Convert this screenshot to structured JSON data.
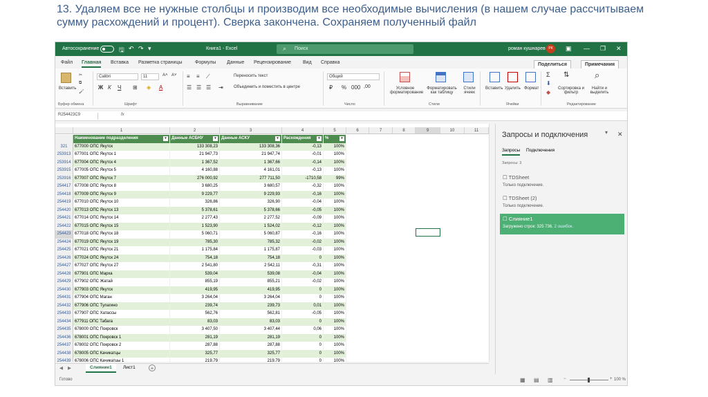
{
  "caption": "13. Удаляем все не нужные столбцы и производим все необходимые вычисления (в нашем случае рассчитываем сумму расхождений и процент). Сверка закончена. Сохраняем полученный файл",
  "titlebar": {
    "autosave": "Автосохранение",
    "title": "Книга1 - Excel",
    "search_placeholder": "Поиск",
    "user": "роман кушнарев",
    "avatar": "РК"
  },
  "tabs": [
    "Файл",
    "Главная",
    "Вставка",
    "Разметка страницы",
    "Формулы",
    "Данные",
    "Рецензирование",
    "Вид",
    "Справка"
  ],
  "tab_actions": {
    "share": "Поделиться",
    "notes": "Примечания"
  },
  "ribbon": {
    "paste": "Вставить",
    "font_name": "Calibri",
    "font_size": "11",
    "wrap_text": "Переносить текст",
    "merge_center": "Объединить и поместить в центре",
    "number_format": "Общий",
    "cond_format": "Условное форматирование",
    "format_table": "Форматировать как таблицу",
    "cell_styles": "Стили ячеек",
    "insert": "Вставить",
    "delete": "Удалить",
    "format": "Формат",
    "sort_filter": "Сортировка и фильтр",
    "find_select": "Найти и выделить",
    "groups": {
      "clipboard": "Буфер обмена",
      "font": "Шрифт",
      "alignment": "Выравнивание",
      "number": "Число",
      "styles": "Стили",
      "cells": "Ячейки",
      "editing": "Редактирование"
    }
  },
  "formula_bar": {
    "name_box": "R254423C9",
    "fx": "fx",
    "value": ""
  },
  "columns": [
    "1",
    "2",
    "3",
    "4",
    "5",
    "6",
    "7",
    "8",
    "9",
    "10",
    "11"
  ],
  "table_headers": [
    "Наименование подразделения",
    "Данные АСБНУ",
    "Данные АСКУ",
    "Расхождения",
    "%"
  ],
  "rows": [
    {
      "n": "321",
      "name": "677000 ОПС Якутск",
      "a": "133 308,23",
      "b": "133 308,36",
      "diff": "-0,13",
      "pct": "100%"
    },
    {
      "n": "253913",
      "name": "677001 ОПС Якутск 1",
      "a": "21 947,73",
      "b": "21 947,74",
      "diff": "-0,01",
      "pct": "100%"
    },
    {
      "n": "253914",
      "name": "677004 ОПС Якутск 4",
      "a": "1 367,52",
      "b": "1 367,66",
      "diff": "-0,14",
      "pct": "100%"
    },
    {
      "n": "253915",
      "name": "677005 ОПС Якутск 5",
      "a": "4 160,88",
      "b": "4 161,01",
      "diff": "-0,13",
      "pct": "100%"
    },
    {
      "n": "253916",
      "name": "677007 ОПС Якутск 7",
      "a": "276 000,92",
      "b": "277 711,50",
      "diff": "-1710,58",
      "pct": "99%"
    },
    {
      "n": "254417",
      "name": "677008 ОПС Якутск 8",
      "a": "3 680,25",
      "b": "3 680,57",
      "diff": "-0,32",
      "pct": "100%"
    },
    {
      "n": "254418",
      "name": "677009 ОПС Якутск 9",
      "a": "9 229,77",
      "b": "9 229,93",
      "diff": "-0,16",
      "pct": "100%"
    },
    {
      "n": "254419",
      "name": "677010 ОПС Якутск 10",
      "a": "326,86",
      "b": "326,90",
      "diff": "-0,04",
      "pct": "100%"
    },
    {
      "n": "254420",
      "name": "677013 ОПС Якутск 13",
      "a": "5 378,61",
      "b": "5 378,66",
      "diff": "-0,05",
      "pct": "100%"
    },
    {
      "n": "254421",
      "name": "677014 ОПС Якутск 14",
      "a": "2 277,43",
      "b": "2 277,52",
      "diff": "-0,09",
      "pct": "100%"
    },
    {
      "n": "254422",
      "name": "677015 ОПС Якутск 15",
      "a": "1 523,90",
      "b": "1 524,02",
      "diff": "-0,12",
      "pct": "100%"
    },
    {
      "n": "254423",
      "name": "677018 ОПС Якутск 18",
      "a": "5 060,71",
      "b": "5 060,87",
      "diff": "-0,16",
      "pct": "100%"
    },
    {
      "n": "254424",
      "name": "677019 ОПС Якутск 19",
      "a": "785,30",
      "b": "785,32",
      "diff": "-0,02",
      "pct": "100%"
    },
    {
      "n": "254425",
      "name": "677021 ОПС Якутск 21",
      "a": "1 175,84",
      "b": "1 175,87",
      "diff": "-0,03",
      "pct": "100%"
    },
    {
      "n": "254426",
      "name": "677024 ОПС Якутск 24",
      "a": "754,18",
      "b": "754,18",
      "diff": "0",
      "pct": "100%"
    },
    {
      "n": "254427",
      "name": "677027 ОПС Якутск 27",
      "a": "2 541,80",
      "b": "2 542,11",
      "diff": "-0,31",
      "pct": "100%"
    },
    {
      "n": "254428",
      "name": "677901 ОПС Марха",
      "a": "539,04",
      "b": "539,08",
      "diff": "-0,04",
      "pct": "100%"
    },
    {
      "n": "254429",
      "name": "677902 ОПС Жатай",
      "a": "855,19",
      "b": "855,21",
      "diff": "-0,02",
      "pct": "100%"
    },
    {
      "n": "254430",
      "name": "677903 ОПС Якутск",
      "a": "419,95",
      "b": "419,95",
      "diff": "0",
      "pct": "100%"
    },
    {
      "n": "254431",
      "name": "677904 ОПС Маган",
      "a": "3 264,04",
      "b": "3 264,04",
      "diff": "0",
      "pct": "100%"
    },
    {
      "n": "254432",
      "name": "677906 ОПС Тулагино",
      "a": "239,74",
      "b": "239,73",
      "diff": "0,01",
      "pct": "100%"
    },
    {
      "n": "254433",
      "name": "677907 ОПС Хатассы",
      "a": "562,76",
      "b": "562,81",
      "diff": "-0,05",
      "pct": "100%"
    },
    {
      "n": "254434",
      "name": "677911 ОПС Табага",
      "a": "83,03",
      "b": "83,03",
      "diff": "0",
      "pct": "100%"
    },
    {
      "n": "254435",
      "name": "678000 ОПС Покровск",
      "a": "3 407,50",
      "b": "3 407,44",
      "diff": "0,06",
      "pct": "100%"
    },
    {
      "n": "254436",
      "name": "678001 ОПС Покровск 1",
      "a": "281,19",
      "b": "281,19",
      "diff": "0",
      "pct": "100%"
    },
    {
      "n": "254437",
      "name": "678002 ОПС Покровск 2",
      "a": "287,88",
      "b": "287,88",
      "diff": "0",
      "pct": "100%"
    },
    {
      "n": "254438",
      "name": "678005 ОПС Качикатцы",
      "a": "325,77",
      "b": "325,77",
      "diff": "0",
      "pct": "100%"
    },
    {
      "n": "254439",
      "name": "678006 ОПС Качикатцы 1",
      "a": "219,79",
      "b": "219,79",
      "diff": "0",
      "pct": "100%"
    }
  ],
  "sheets": [
    "Слияние1",
    "Лист1"
  ],
  "status": {
    "ready": "Готово",
    "zoom": "100 %"
  },
  "pane": {
    "title": "Запросы и подключения",
    "tab_queries": "Запросы",
    "tab_connections": "Подключения",
    "count": "Запросы: 3",
    "items": [
      {
        "name": "TDSheet",
        "status": "Только подключение."
      },
      {
        "name": "TDSheet (2)",
        "status": "Только подключение."
      },
      {
        "name": "Слияние1",
        "status": "Загружено строк: 325 736.",
        "errors": "2 ошибок."
      }
    ]
  }
}
